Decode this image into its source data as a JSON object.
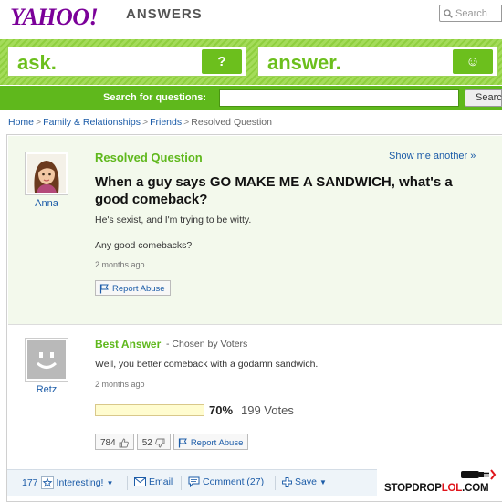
{
  "header": {
    "logo_main": "YAHOO!",
    "logo_sub": "ANSWERS",
    "search_placeholder": "Search"
  },
  "band": {
    "ask_label": "ask.",
    "ask_button_glyph": "?",
    "answer_label": "answer.",
    "answer_button_glyph": "☺"
  },
  "search_row": {
    "label": "Search for questions:",
    "input_value": "",
    "button_label": "Search"
  },
  "breadcrumb": {
    "items": [
      "Home",
      "Family & Relationships",
      "Friends"
    ],
    "current": "Resolved Question",
    "separator": ">"
  },
  "question": {
    "status": "Resolved Question",
    "show_another": "Show me another »",
    "asker_name": "Anna",
    "title": "When a guy says GO MAKE ME A SANDWICH, what's a good comeback?",
    "body_line1": "He's sexist, and I'm trying to be witty.",
    "body_line2": "Any good comebacks?",
    "timestamp": "2 months ago",
    "report_label": "Report Abuse"
  },
  "best_answer": {
    "heading": "Best Answer",
    "chosen_by": "- Chosen by Voters",
    "answerer_name": "Retz",
    "text": "Well, you better comeback with a godamn sandwich.",
    "timestamp": "2 months ago",
    "vote_percent_value": 70,
    "vote_percent": "70%",
    "vote_count": "199 Votes",
    "thumbs_up": "784",
    "thumbs_down": "52",
    "report_label": "Report Abuse"
  },
  "toolbar": {
    "interesting_count": "177",
    "interesting_label": "Interesting!",
    "email_label": "Email",
    "comment_label": "Comment (27)",
    "save_label": "Save"
  },
  "watermark": {
    "part1": "STOPDROP",
    "part2": "LOL",
    "part3": ".COM"
  },
  "colors": {
    "brand_purple": "#7b0099",
    "accent_green": "#6cbf1d",
    "link_blue": "#1c5ca8",
    "vote_bar_fill": "#fffccf"
  }
}
